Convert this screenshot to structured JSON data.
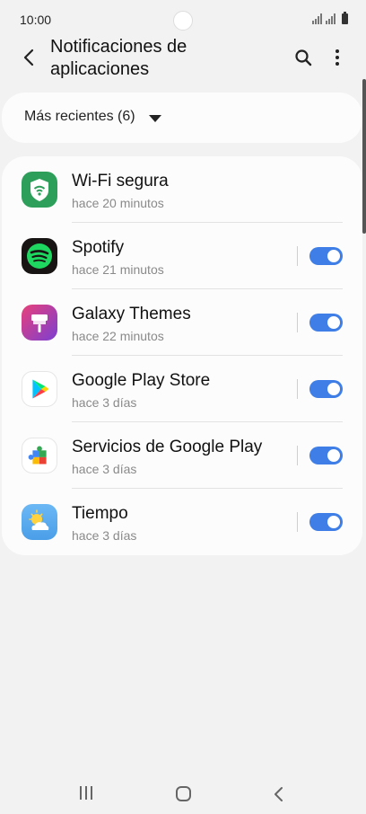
{
  "status": {
    "time": "10:00"
  },
  "header": {
    "title": "Notificaciones de aplicaciones",
    "back_icon": "back-arrow-icon",
    "search_icon": "search-icon",
    "more_icon": "more-vertical-icon"
  },
  "filter": {
    "label": "Más recientes (6)",
    "icon": "dropdown-arrow-icon"
  },
  "apps": [
    {
      "name": "Wi-Fi segura",
      "time": "hace 20 minutos",
      "icon": "wifi-secure-icon",
      "has_toggle": false
    },
    {
      "name": "Spotify",
      "time": "hace 21 minutos",
      "icon": "spotify-icon",
      "has_toggle": true,
      "enabled": true
    },
    {
      "name": "Galaxy Themes",
      "time": "hace 22 minutos",
      "icon": "galaxy-themes-icon",
      "has_toggle": true,
      "enabled": true
    },
    {
      "name": "Google Play Store",
      "time": "hace 3 días",
      "icon": "play-store-icon",
      "has_toggle": true,
      "enabled": true
    },
    {
      "name": "Servicios de Google Play",
      "time": "hace 3 días",
      "icon": "google-play-services-icon",
      "has_toggle": true,
      "enabled": true
    },
    {
      "name": "Tiempo",
      "time": "hace 3 días",
      "icon": "weather-icon",
      "has_toggle": true,
      "enabled": true
    }
  ],
  "colors": {
    "accent": "#3e7ee6",
    "background": "#f2f2f2",
    "card": "#fcfcfc"
  }
}
